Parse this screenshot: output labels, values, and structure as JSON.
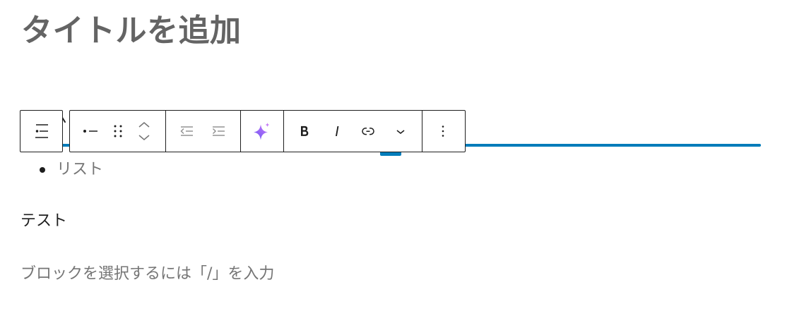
{
  "editor": {
    "title_placeholder": "タイトルを追加"
  },
  "block_toolbar": {
    "parent_selector_icon": "list-icon",
    "groups": [
      [
        "list-item-icon",
        "drag-handle-icon",
        "chevron-up-icon",
        "chevron-down-icon"
      ],
      [
        "outdent-icon",
        "indent-icon"
      ],
      [
        "sparkle-icon"
      ],
      [
        "bold-icon",
        "italic-icon",
        "link-icon",
        "chevron-down-icon"
      ],
      [
        "more-vertical-icon"
      ]
    ]
  },
  "content": {
    "list_items": [
      "リスト"
    ],
    "paragraph": "テスト",
    "appender_placeholder": "ブロックを選択するには「/」を入力"
  },
  "colors": {
    "accent": "#007cba",
    "title_placeholder": "#646464",
    "text": "#1e1e1e",
    "muted_text": "#757575",
    "disabled_icon": "#949494",
    "ai_gradient_start": "#6e55f5",
    "ai_gradient_end": "#d27ef6",
    "surface": "#ffffff"
  }
}
